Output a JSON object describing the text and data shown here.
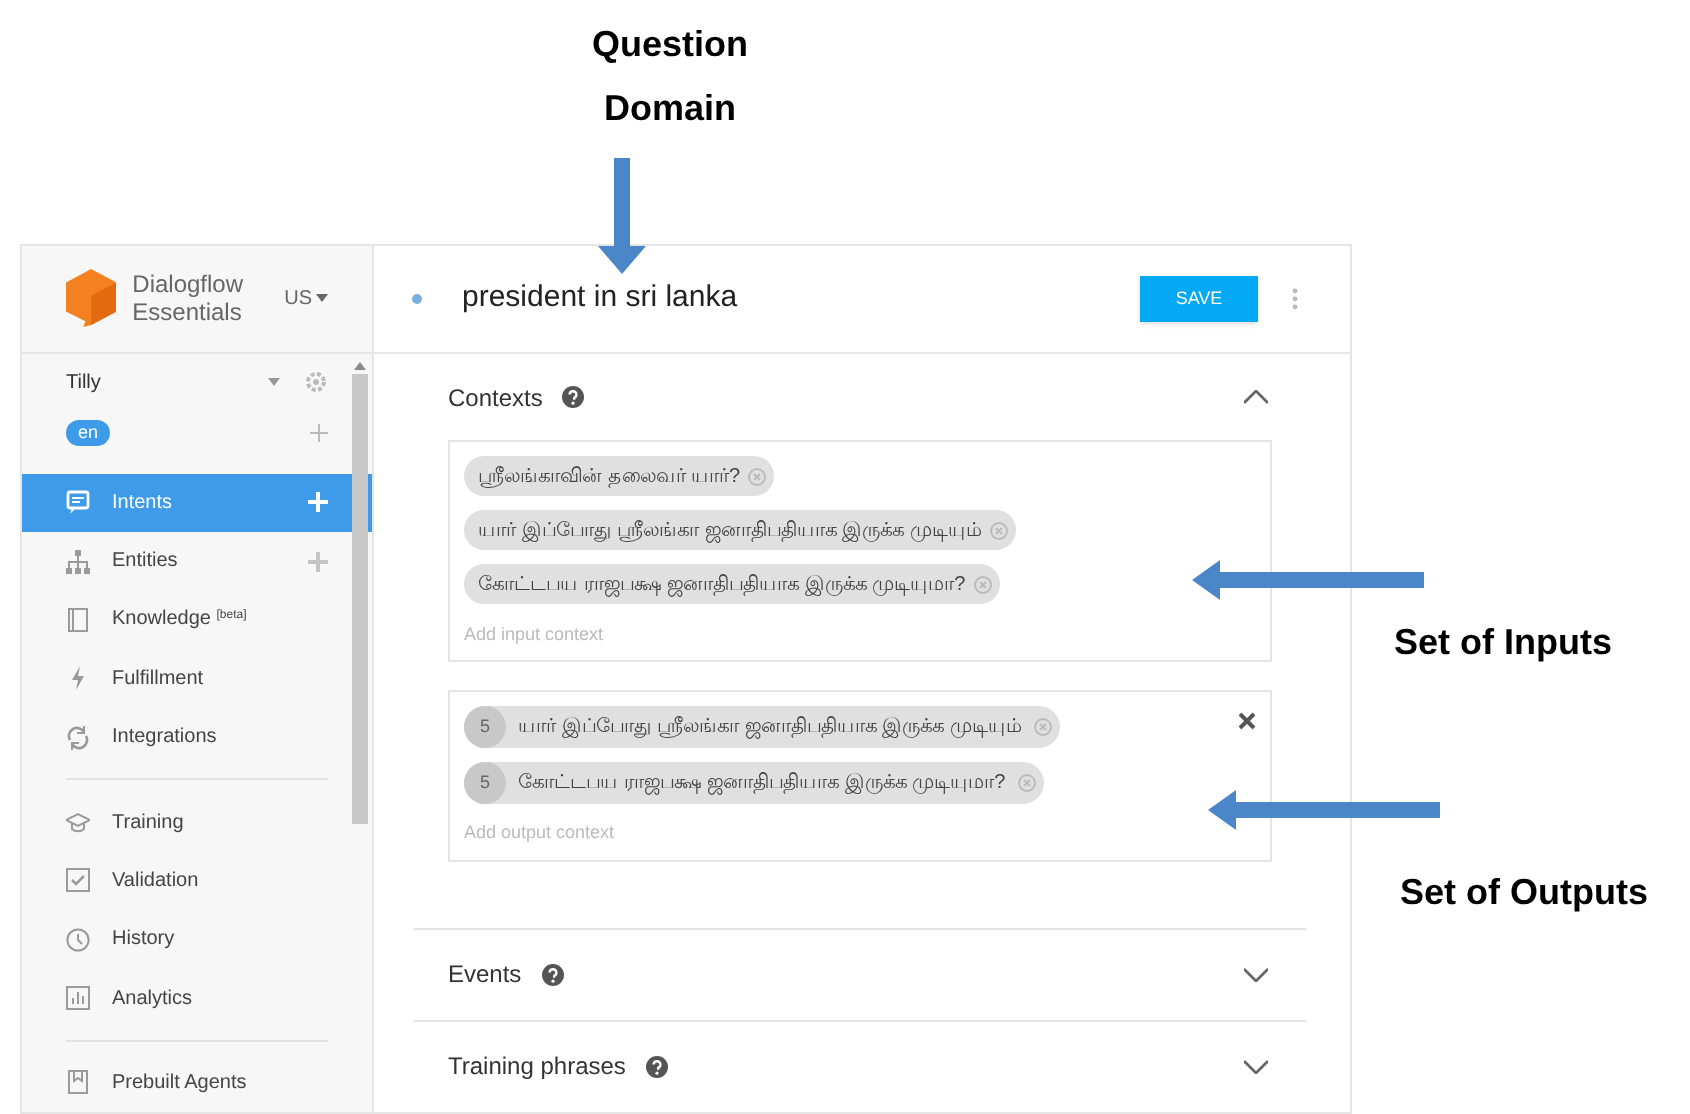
{
  "annotations": [
    {
      "text": "Question Domain"
    },
    {
      "text": "Set of Inputs"
    },
    {
      "text": "Set of Outputs"
    }
  ],
  "sidebar": {
    "logo_text": "Dialogflow Essentials",
    "region": "US",
    "agent": "Tilly",
    "language": "en",
    "groups": [
      [
        {
          "label": "Intents",
          "selected": true,
          "add": true
        },
        {
          "label": "Entities",
          "selected": false,
          "add": true
        },
        {
          "label": "Knowledge $^{[beta]}$",
          "selected": false,
          "add": false
        },
        {
          "label": "Fulfillment",
          "selected": false,
          "add": false
        },
        {
          "label": "Integrations",
          "selected": false,
          "add": false
        }
      ],
      [
        {
          "label": "Training",
          "selected": false,
          "add": false
        },
        {
          "label": "Validation",
          "selected": false,
          "add": false
        },
        {
          "label": "History",
          "selected": false,
          "add": false
        },
        {
          "label": "Analytics",
          "selected": false,
          "add": false
        }
      ],
      [
        {
          "label": "Prebuilt Agents",
          "selected": false,
          "add": false
        }
      ]
    ]
  },
  "intent": {
    "title": "president in sri lanka",
    "save": "SAVE"
  },
  "contexts": {
    "label": "Contexts",
    "expanded": true,
    "input": [
      "ஸ்ரீலங்காவின் தலைவர் யார்?",
      "யார் இப்போது ஸ்ரீலங்கா ஜனாதிபதியாக இருக்க முடியும்",
      "கோட்டபய ராஜபக்ஷ ஜனாதிபதியாக இருக்க முடியுமா?"
    ],
    "input_placeholder": "Add input context",
    "output": [
      {
        "lifespan": "5",
        "name": "யார் இப்போது ஸ்ரீலங்கா ஜனாதிபதியாக இருக்க முடியும்"
      },
      {
        "lifespan": "5",
        "name": "கோட்டபய ராஜபக்ஷ ஜனாதிபதியாக இருக்க முடியுமா?"
      }
    ],
    "output_placeholder": "Add output context"
  },
  "sections": [
    {
      "label": "Events",
      "expanded": false
    },
    {
      "label": "Training phrases",
      "expanded": false
    }
  ]
}
